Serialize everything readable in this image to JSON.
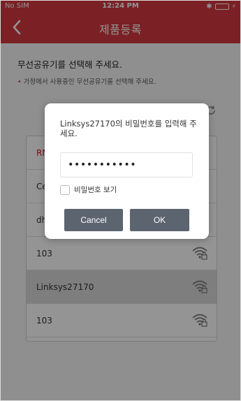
{
  "status_bar": {
    "carrier": "No SIM",
    "time": "12:24 PM",
    "bluetooth": "✱",
    "charging": "⚡"
  },
  "header": {
    "title": "제품등록"
  },
  "page": {
    "heading": "무선공유기를 선택해 주세요.",
    "note_bullet": "•",
    "note": "가정에서 사용중인 무선공유기를 선택해 주세요."
  },
  "networks": [
    {
      "name": "RN"
    },
    {
      "name": "Ce"
    },
    {
      "name": "dh"
    },
    {
      "name": "103"
    },
    {
      "name": "Linksys27170"
    },
    {
      "name": "103"
    }
  ],
  "dialog": {
    "message": "Linksys27170의 비밀번호를 입력해 주세요.",
    "password_value": "•••••••••••",
    "show_password_label": "비밀번호 보기",
    "cancel_label": "Cancel",
    "ok_label": "OK"
  },
  "colors": {
    "header": "#d4383e",
    "button": "#5c6470",
    "accent": "#c8252b"
  }
}
